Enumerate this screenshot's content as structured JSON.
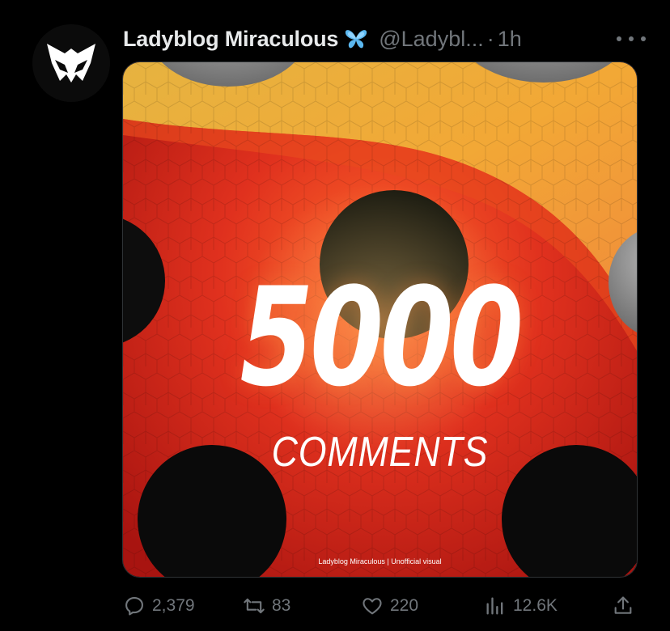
{
  "author": {
    "name": "Ladyblog Miraculous",
    "handle": "@Ladybl...",
    "separator": "·",
    "time": "1h"
  },
  "media": {
    "headline_number": "5000",
    "headline_label": "COMMENTS",
    "credit": "Ladyblog Miraculous | Unofficial visual"
  },
  "actions": {
    "replies": "2,379",
    "retweets": "83",
    "likes": "220",
    "views": "12.6K"
  },
  "colors": {
    "background": "#000000",
    "text_primary": "#e7e9ea",
    "text_secondary": "#71767b",
    "badge_blue": "#5bb8f0",
    "ladybug_red": "#d4261f",
    "accent_orange": "#f0a030"
  },
  "icons": {
    "avatar": "hawkmoth-mask-icon",
    "badge": "butterfly-icon",
    "more": "more-icon",
    "reply": "reply-icon",
    "retweet": "retweet-icon",
    "like": "heart-icon",
    "views": "views-icon",
    "share": "share-icon"
  }
}
